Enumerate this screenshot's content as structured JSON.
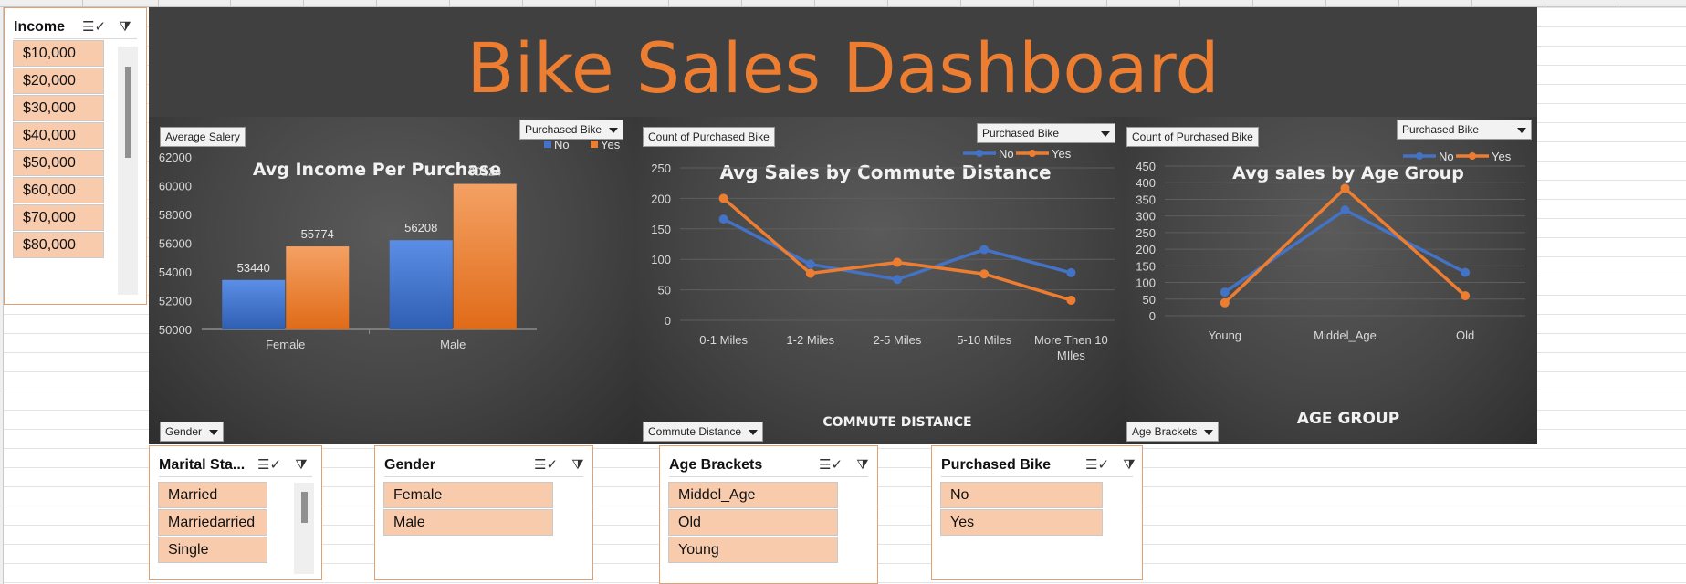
{
  "dashboard": {
    "title": "Bike Sales Dashboard",
    "accent": "#ed7d31",
    "no_color": "#4472c4",
    "yes_color": "#ed7d31"
  },
  "charts": {
    "income": {
      "field_button": "Average Salery",
      "series_button": "Purchased Bike",
      "axis_button": "Gender",
      "legend": [
        "No",
        "Yes"
      ]
    },
    "commute": {
      "field_button": "Count of Purchased Bike",
      "series_button": "Purchased Bike",
      "axis_button": "Commute Distance",
      "legend": [
        "No",
        "Yes"
      ]
    },
    "age": {
      "field_button": "Count of Purchased Bike",
      "series_button": "Purchased Bike",
      "axis_button": "Age Brackets",
      "legend": [
        "No",
        "Yes"
      ]
    }
  },
  "chart_data": [
    {
      "type": "bar",
      "title": "Avg Income Per Purchase",
      "categories": [
        "Female",
        "Male"
      ],
      "series": [
        {
          "name": "No",
          "values": [
            53440,
            56208
          ]
        },
        {
          "name": "Yes",
          "values": [
            55774,
            60124
          ]
        }
      ],
      "ylim": [
        50000,
        62000
      ],
      "yticks": [
        50000,
        52000,
        54000,
        56000,
        58000,
        60000,
        62000
      ],
      "xlabel": "",
      "ylabel": "",
      "legend": "top-right"
    },
    {
      "type": "line",
      "title": "Avg Sales by Commute Distance",
      "categories": [
        "0-1 Miles",
        "1-2 Miles",
        "2-5 Miles",
        "5-10 Miles",
        "More Then 10 MIles"
      ],
      "series": [
        {
          "name": "No",
          "values": [
            166,
            92,
            67,
            116,
            78
          ]
        },
        {
          "name": "Yes",
          "values": [
            200,
            77,
            95,
            76,
            33
          ]
        }
      ],
      "ylim": [
        0,
        250
      ],
      "yticks": [
        0,
        50,
        100,
        150,
        200,
        250
      ],
      "xlabel": "COMMUTE DISTANCE",
      "ylabel": "",
      "legend": "top-right"
    },
    {
      "type": "line",
      "title": "Avg sales by Age Group",
      "categories": [
        "Young",
        "Middel_Age",
        "Old"
      ],
      "series": [
        {
          "name": "No",
          "values": [
            71,
            318,
            130
          ]
        },
        {
          "name": "Yes",
          "values": [
            39,
            383,
            60
          ]
        }
      ],
      "ylim": [
        0,
        450
      ],
      "yticks": [
        0,
        50,
        100,
        150,
        200,
        250,
        300,
        350,
        400,
        450
      ],
      "xlabel": "AGE GROUP",
      "ylabel": "",
      "legend": "top-right"
    }
  ],
  "slicers": {
    "income": {
      "title": "Income",
      "items": [
        "$10,000",
        "$20,000",
        "$30,000",
        "$40,000",
        "$50,000",
        "$60,000",
        "$70,000",
        "$80,000"
      ]
    },
    "marital": {
      "title": "Marital Sta...",
      "items": [
        "Married",
        "Marriedarried",
        "Single"
      ]
    },
    "gender": {
      "title": "Gender",
      "items": [
        "Female",
        "Male"
      ]
    },
    "age": {
      "title": "Age Brackets",
      "items": [
        "Middel_Age",
        "Old",
        "Young"
      ]
    },
    "purchased": {
      "title": "Purchased Bike",
      "items": [
        "No",
        "Yes"
      ]
    }
  },
  "icons": {
    "multi_select": "multi-select-icon",
    "clear_filter": "clear-filter-icon"
  }
}
